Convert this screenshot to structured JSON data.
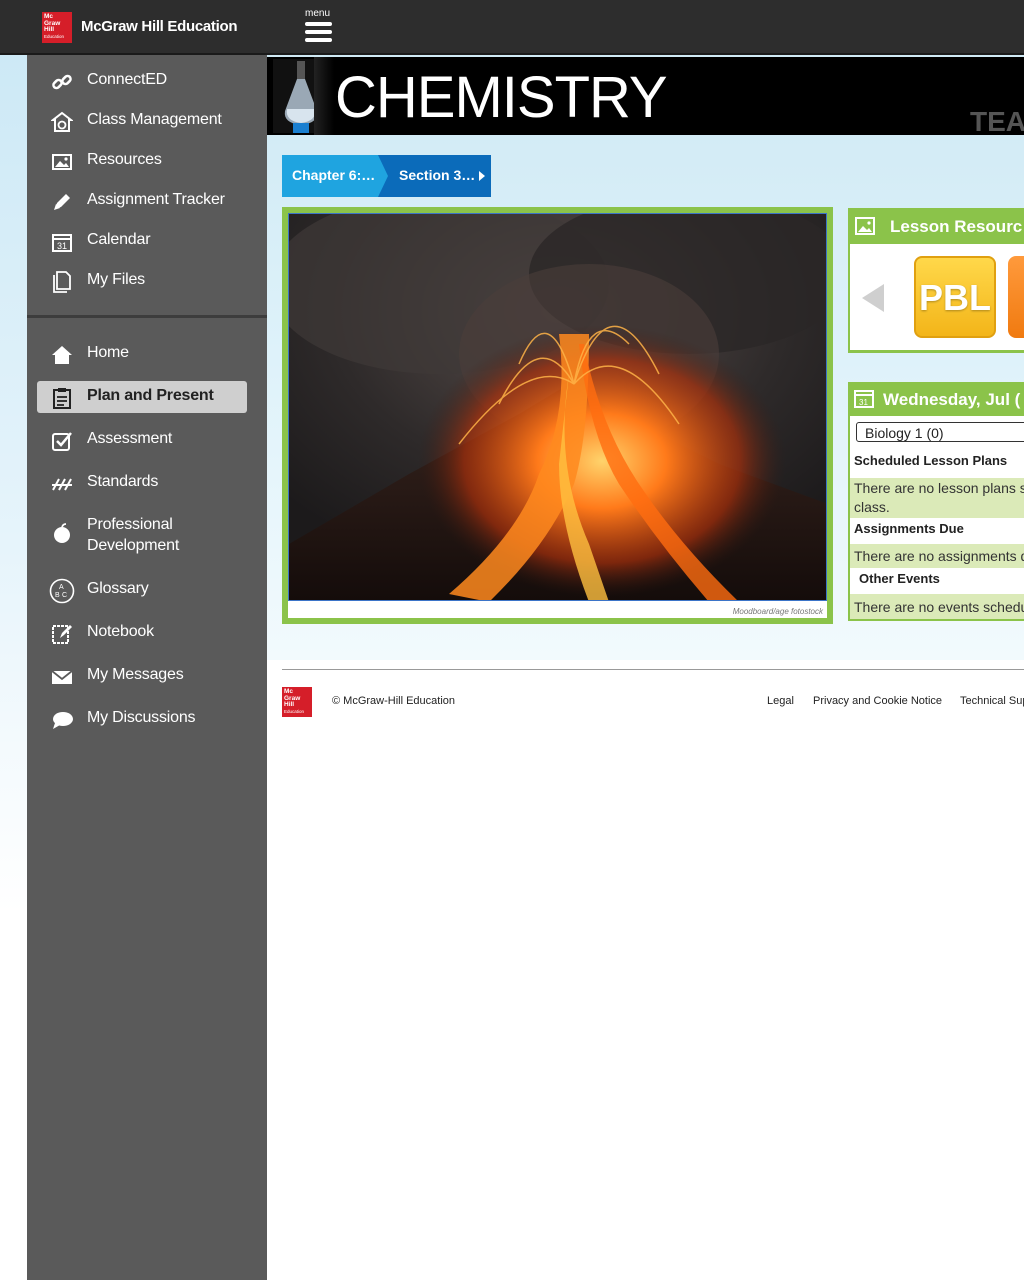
{
  "header": {
    "logo_lines": [
      "Mc",
      "Graw",
      "Hill",
      "Education"
    ],
    "brand": "McGraw Hill Education",
    "menu_label": "menu"
  },
  "sidebar": {
    "top_items": [
      {
        "label": "ConnectED",
        "icon": "link-icon"
      },
      {
        "label": "Class Management",
        "icon": "class-management-icon"
      },
      {
        "label": "Resources",
        "icon": "image-icon"
      },
      {
        "label": "Assignment Tracker",
        "icon": "pencil-icon"
      },
      {
        "label": "Calendar",
        "icon": "calendar-icon"
      },
      {
        "label": "My Files",
        "icon": "files-icon"
      }
    ],
    "main_items": [
      {
        "label": "Home",
        "icon": "home-icon"
      },
      {
        "label": "Plan and Present",
        "icon": "clipboard-icon",
        "active": true
      },
      {
        "label": "Assessment",
        "icon": "checkbox-icon"
      },
      {
        "label": "Standards",
        "icon": "standards-icon"
      },
      {
        "label": "Professional Development",
        "icon": "apple-icon"
      },
      {
        "label": "Glossary",
        "icon": "abc-icon"
      },
      {
        "label": "Notebook",
        "icon": "notebook-icon"
      },
      {
        "label": "My Messages",
        "icon": "envelope-icon"
      },
      {
        "label": "My Discussions",
        "icon": "speech-bubble-icon"
      }
    ]
  },
  "banner": {
    "title": "CHEMISTRY",
    "corner_text": "TEA"
  },
  "breadcrumb": {
    "chapter": "Chapter 6:…",
    "section": "Section 3…"
  },
  "photo": {
    "credit": "Moodboard/age fotostock"
  },
  "lesson_resources": {
    "title": "Lesson Resourc",
    "tile_label": "PBL"
  },
  "calendar": {
    "title": "Wednesday, Jul (",
    "class_select": "Biology 1 (0)",
    "scheduled_head": "Scheduled Lesson Plans",
    "scheduled_msg": "There are no lesson plans s class.",
    "assignments_head": "Assignments Due",
    "assignments_msg": "There are no assignments d",
    "events_head": "Other Events",
    "events_msg": "There are no events schedu"
  },
  "footer": {
    "logo_lines": [
      "Mc",
      "Graw",
      "Hill",
      "Education"
    ],
    "copyright": "© McGraw-Hill Education",
    "links": [
      "Legal",
      "Privacy and Cookie Notice",
      "Technical Sup"
    ]
  },
  "colors": {
    "topbar": "#2d2d2d",
    "sidebar": "#5a5a5a",
    "accent_green": "#8bc34a",
    "crumb_light": "#1fa4e0",
    "crumb_dark": "#0b6bba",
    "brand_red": "#d51e29"
  }
}
